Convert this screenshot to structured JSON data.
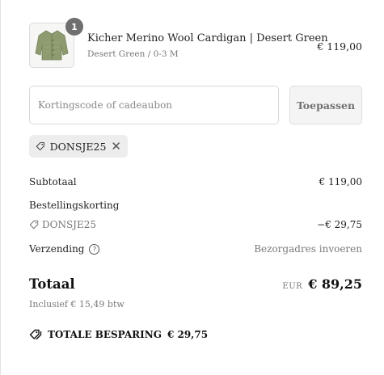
{
  "product": {
    "quantity": "1",
    "name": "Kicher Merino Wool Cardigan | Desert Green",
    "variant": "Desert Green / 0-3 M",
    "price": "€ 119,00"
  },
  "discount": {
    "placeholder": "Kortingscode of cadeaubon",
    "value": "",
    "apply_label": "Toepassen",
    "applied_code": "DONSJE25"
  },
  "summary": {
    "subtotal_label": "Subtotaal",
    "subtotal_value": "€ 119,00",
    "order_discount_label": "Bestellingskorting",
    "order_discount_code": "DONSJE25",
    "order_discount_value": "−€ 29,75",
    "shipping_label": "Verzending",
    "shipping_value": "Bezorgadres invoeren",
    "total_label": "Totaal",
    "total_currency": "EUR",
    "total_value": "€ 89,25",
    "tax_note": "Inclusief € 15,49 btw",
    "savings_label": "TOTALE BESPARING",
    "savings_value": "€ 29,75"
  },
  "colors": {
    "cardigan": "#8e9a70",
    "chip_bg": "#ededed",
    "button_bg": "#f4f4f4"
  }
}
